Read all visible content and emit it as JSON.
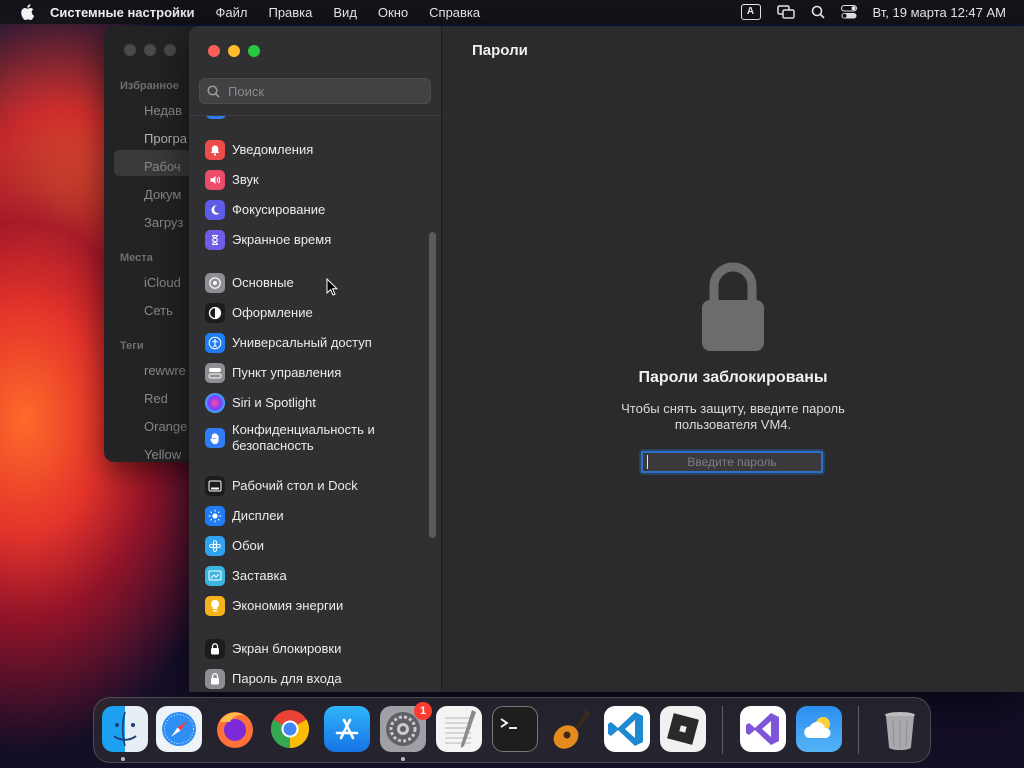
{
  "menubar": {
    "app": "Системные настройки",
    "items": [
      "Файл",
      "Правка",
      "Вид",
      "Окно",
      "Справка"
    ],
    "input_source": "A",
    "datetime": "Вт, 19 марта  12:47 AM"
  },
  "finder": {
    "sections": {
      "favorites": "Избранное",
      "places": "Места",
      "tags": "Теги"
    },
    "favorites": [
      "Недав",
      "Програ",
      "Рабоч",
      "Докум",
      "Загруз"
    ],
    "places": [
      "iCloud",
      "Сеть"
    ],
    "tags": [
      "rewwre",
      "Red",
      "Orange",
      "Yellow"
    ]
  },
  "settings": {
    "search": {
      "placeholder": "Поиск",
      "value": ""
    },
    "sidebar": [
      {
        "label": "Уведомления",
        "icon": "bell-icon",
        "color": "#ec4b4b"
      },
      {
        "label": "Звук",
        "icon": "speaker-icon",
        "color": "#ec4b6a"
      },
      {
        "label": "Фокусирование",
        "icon": "moon-icon",
        "color": "#5e5ce6"
      },
      {
        "label": "Экранное время",
        "icon": "hourglass-icon",
        "color": "#6e5ce6"
      },
      {
        "label": "Основные",
        "icon": "gear-icon",
        "color": "#8e8e93"
      },
      {
        "label": "Оформление",
        "icon": "appearance-icon",
        "color": "#1c1c1e"
      },
      {
        "label": "Универсальный доступ",
        "icon": "accessibility-icon",
        "color": "#1f7cf3"
      },
      {
        "label": "Пункт управления",
        "icon": "control-center-icon",
        "color": "#8e8e93"
      },
      {
        "label": "Siri и Spotlight",
        "icon": "siri-icon",
        "color": "#3a2a5e"
      },
      {
        "label": "Конфиденциальность и безопасность",
        "icon": "hand-icon",
        "color": "#2f7cf6"
      },
      {
        "label": "Рабочий стол и Dock",
        "icon": "dock-icon",
        "color": "#1c1c1e"
      },
      {
        "label": "Дисплеи",
        "icon": "sun-icon",
        "color": "#1f7cf3"
      },
      {
        "label": "Обои",
        "icon": "wallpaper-icon",
        "color": "#2fa3f0"
      },
      {
        "label": "Заставка",
        "icon": "screensaver-icon",
        "color": "#3ab6e0"
      },
      {
        "label": "Экономия энергии",
        "icon": "bulb-icon",
        "color": "#f5b21b"
      },
      {
        "label": "Экран блокировки",
        "icon": "lock-screen-icon",
        "color": "#1c1c1e"
      },
      {
        "label": "Пароль для входа",
        "icon": "lock-icon",
        "color": "#8e8e93"
      }
    ],
    "content": {
      "title": "Пароли",
      "locked_heading": "Пароли заблокированы",
      "locked_text": "Чтобы снять защиту, введите пароль пользователя VM4.",
      "password_placeholder": "Введите пароль",
      "password_value": ""
    }
  },
  "dock": {
    "apps": [
      "Finder",
      "Safari",
      "Firefox",
      "Chrome",
      "App Store",
      "Системные настройки",
      "TextEdit",
      "Terminal",
      "GarageBand",
      "VS Code",
      "Roblox",
      "Visual Studio",
      "Погода",
      "Корзина"
    ],
    "settings_badge": "1"
  }
}
